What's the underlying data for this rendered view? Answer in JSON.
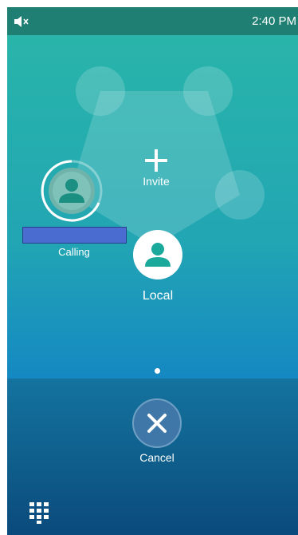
{
  "status_bar": {
    "time": "2:40 PM",
    "mute_icon": "speaker-muted-icon"
  },
  "conference": {
    "invite_label": "Invite",
    "invite_icon": "plus-icon",
    "participants": [
      {
        "label": "Calling",
        "icon": "person-icon"
      },
      {
        "label": "Local",
        "icon": "person-icon"
      }
    ],
    "page_indicator": {
      "pages": 1,
      "current": 1
    }
  },
  "actions": {
    "cancel_label": "Cancel",
    "cancel_icon": "close-icon",
    "dialpad_icon": "dialpad-icon"
  },
  "colors": {
    "status_bar": "#1f7f73",
    "stage_top": "#2bb6a9",
    "stage_bottom": "#1488c2",
    "panel_bottom": "#0a4a7c",
    "avatar_teal": "#1aa99a"
  }
}
